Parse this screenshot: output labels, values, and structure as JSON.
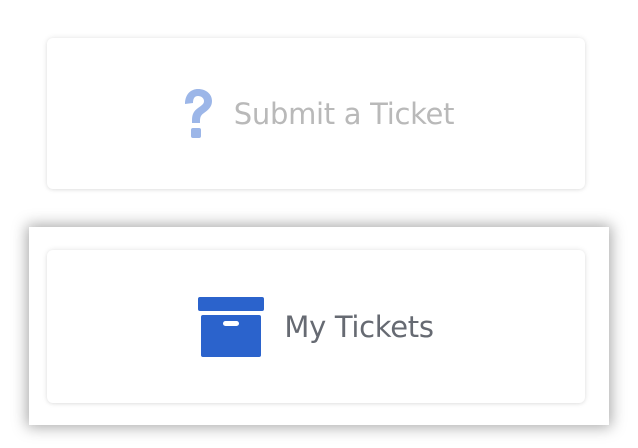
{
  "cards": {
    "submit": {
      "label": "Submit a Ticket",
      "icon": "question-mark-icon",
      "icon_color": "#9cb6e8",
      "text_color": "#b9b9b9",
      "state": "dimmed"
    },
    "my_tickets": {
      "label": "My Tickets",
      "icon": "archive-box-icon",
      "icon_color": "#2b63cc",
      "text_color": "#666a72",
      "state": "selected"
    }
  }
}
